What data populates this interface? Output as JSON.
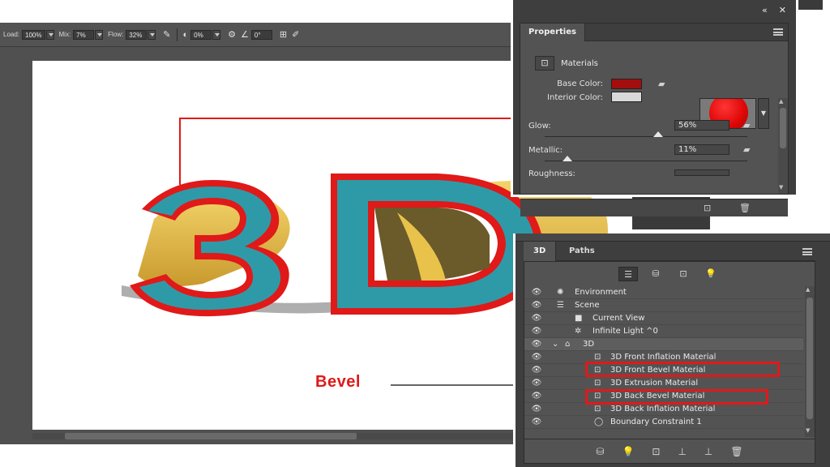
{
  "options_bar": {
    "load_label": "Load:",
    "load_value": "100%",
    "mix_label": "Mix:",
    "mix_value": "7%",
    "flow_label": "Flow:",
    "flow_value": "32%",
    "airbrush_icon": "airbrush-icon",
    "angle_value": "0%",
    "smoothing_value": "0°"
  },
  "artwork": {
    "text": "3D",
    "callout_label": "Bevel",
    "colors": {
      "face": "#2e9aa8",
      "outline": "#e01919",
      "extrusion": "#e8c24a",
      "shadow": "#6b5a2a"
    }
  },
  "properties": {
    "tab": "Properties",
    "section": "Materials",
    "base_color_label": "Base Color:",
    "interior_color_label": "Interior Color:",
    "base_color": "#a30d0d",
    "interior_color": "#d9d9d9",
    "glow_label": "Glow:",
    "glow_value": "56%",
    "glow_level": 0.56,
    "metallic_label": "Metallic:",
    "metallic_value": "11%",
    "metallic_level": 0.11,
    "roughness_label": "Roughness:"
  },
  "panel3d": {
    "tabs": [
      "3D",
      "Paths"
    ],
    "layers": [
      {
        "name": "Environment",
        "icon": "environment-icon"
      },
      {
        "name": "Scene",
        "icon": "scene-icon"
      },
      {
        "name": "Current View",
        "icon": "camera-icon"
      },
      {
        "name": "Infinite Light ^0",
        "icon": "light-icon"
      },
      {
        "name": "3D",
        "icon": "mesh-icon"
      },
      {
        "name": "3D Front Inflation Material",
        "icon": "material-icon"
      },
      {
        "name": "3D Front Bevel Material",
        "icon": "material-icon"
      },
      {
        "name": "3D Extrusion Material",
        "icon": "material-icon"
      },
      {
        "name": "3D Back Bevel Material",
        "icon": "material-icon"
      },
      {
        "name": "3D Back Inflation Material",
        "icon": "material-icon"
      },
      {
        "name": "Boundary Constraint 1",
        "icon": "constraint-icon"
      }
    ]
  }
}
